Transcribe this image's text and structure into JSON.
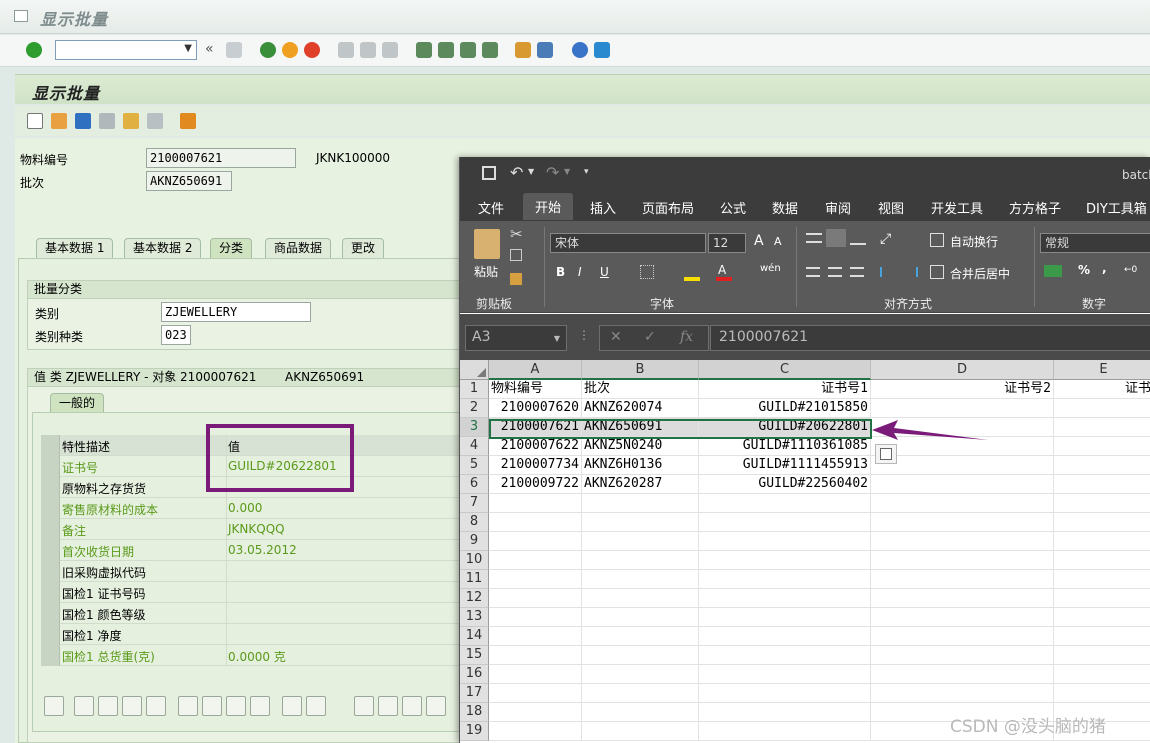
{
  "sap": {
    "window_title": "显示批量",
    "screen_title": "显示批量",
    "fields": {
      "material_label": "物料编号",
      "material_value": "2100007621",
      "material_desc": "JKNK100000",
      "batch_label": "批次",
      "batch_value": "AKNZ650691"
    },
    "tabs": [
      "基本数据 1",
      "基本数据 2",
      "分类",
      "商品数据",
      "更改"
    ],
    "batch_class": {
      "group_title": "批量分类",
      "class_label": "类别",
      "class_value": "ZJEWELLERY",
      "class_type_label": "类别种类",
      "class_type_value": "023"
    },
    "values_group": {
      "title": "值 类 ZJEWELLERY - 对象 2100007621",
      "batch": "AKNZ650691",
      "subtab": "一般的"
    },
    "char_table": {
      "headers": [
        "特性描述",
        "值"
      ],
      "rows": [
        {
          "desc": "证书号",
          "value": "GUILD#20622801",
          "green": true
        },
        {
          "desc": "原物料之存货货",
          "value": "",
          "green": false
        },
        {
          "desc": "寄售原材料的成本",
          "value": "0.000",
          "green": true
        },
        {
          "desc": "备注",
          "value": "JKNKQQQ",
          "green": true
        },
        {
          "desc": "首次收货日期",
          "value": "03.05.2012",
          "green": true
        },
        {
          "desc": "旧采购虚拟代码",
          "value": "",
          "green": false
        },
        {
          "desc": "国检1 证书号码",
          "value": "",
          "green": false
        },
        {
          "desc": "国检1 颜色等级",
          "value": "",
          "green": false
        },
        {
          "desc": "国检1 净度",
          "value": "",
          "green": false
        },
        {
          "desc": "国检1 总货重(克)",
          "value": "0.0000 克",
          "green": true
        }
      ]
    }
  },
  "excel": {
    "file_name": "batch",
    "menu": [
      "文件",
      "开始",
      "插入",
      "页面布局",
      "公式",
      "数据",
      "审阅",
      "视图",
      "开发工具",
      "方方格子",
      "DIY工具箱"
    ],
    "active_menu": "开始",
    "ribbon": {
      "clipboard": {
        "paste": "粘贴",
        "group": "剪贴板"
      },
      "font": {
        "name": "宋体",
        "size": "12",
        "group": "字体"
      },
      "align": {
        "wrap": "自动换行",
        "merge": "合并后居中",
        "group": "对齐方式"
      },
      "number": {
        "format": "常规",
        "group": "数字"
      }
    },
    "name_box": "A3",
    "formula_value": "2100007621",
    "fx": "fx",
    "columns": [
      "A",
      "B",
      "C",
      "D",
      "E"
    ],
    "row_numbers": [
      "1",
      "2",
      "3",
      "4",
      "5",
      "6",
      "7",
      "8",
      "9",
      "10",
      "11",
      "12",
      "13",
      "14",
      "15",
      "16",
      "17",
      "18",
      "19"
    ],
    "header_row": [
      "物料编号",
      "批次",
      "证书号1",
      "证书号2",
      "证书"
    ],
    "rows": [
      [
        "2100007620",
        "AKNZ620074",
        "GUILD#21015850"
      ],
      [
        "2100007621",
        "AKNZ650691",
        "GUILD#20622801"
      ],
      [
        "2100007622",
        "AKNZ5N0240",
        "GUILD#1110361085"
      ],
      [
        "2100007734",
        "AKNZ6H0136",
        "GUILD#1111455913"
      ],
      [
        "2100009722",
        "AKNZ620287",
        "GUILD#22560402"
      ]
    ]
  },
  "watermark": "CSDN @没头脑的猪",
  "colors": {
    "highlight_box": "#7a1b7a",
    "arrow": "#7a1b7a",
    "excel_green": "#217346",
    "sap_green_text": "#5a9a1a"
  }
}
